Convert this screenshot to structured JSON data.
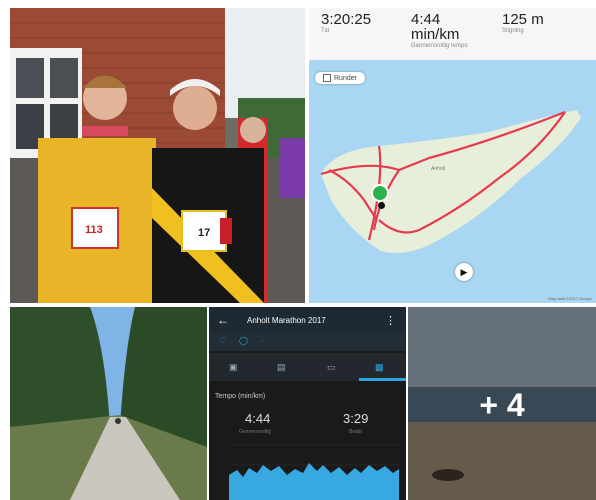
{
  "map": {
    "stats": [
      {
        "value": "3:20:25",
        "label": "Tid"
      },
      {
        "value": "4:44 min/km",
        "label": "Gennemsnitlig tempo"
      },
      {
        "value": "125 m",
        "label": "Stigning"
      }
    ],
    "runder_label": "Runder",
    "island_label": "Anholt",
    "attribution": "Map data ©2017 Google"
  },
  "app": {
    "title": "Anholt Marathon 2017",
    "tempo_header": "Tempo (min/km)",
    "avg_value": "4:44",
    "avg_label": "Gennemsnitlig",
    "best_value": "3:29",
    "best_label": "Bedst"
  },
  "overlay": {
    "more_count": "+ 4"
  },
  "bibs": {
    "left": "113",
    "right": "17"
  }
}
